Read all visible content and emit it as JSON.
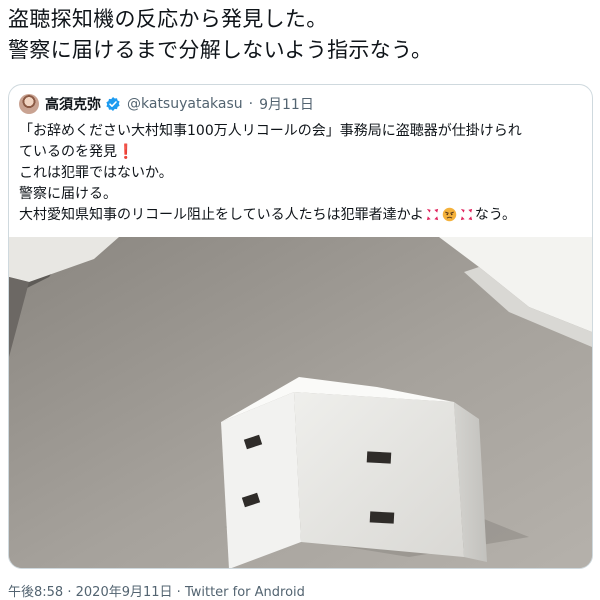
{
  "tweet": {
    "text_line1": "盗聴探知機の反応から発見した。",
    "text_line2": "警察に届けるまで分解しないよう指示なう。"
  },
  "quote": {
    "display_name": "高須克弥",
    "handle": "@katsuyatakasu",
    "separator": "·",
    "date": "9月11日",
    "line1": "「お辞めください大村知事100万人リコールの会」事務局に盗聴器が仕掛けられ",
    "line2_text": "ているのを発見",
    "line2_mark": "❗",
    "line3": "これは犯罪ではないか。",
    "line4": "警察に届ける。",
    "line5_text": "大村愛知県知事のリコール阻止をしている人たちは犯罪者達かよ",
    "line5_suffix": "なう。",
    "emoji_names": [
      "anger-symbol-icon",
      "angry-face-icon",
      "anger-symbol-icon"
    ],
    "verified_color": "#1d9bf0"
  },
  "footer": {
    "time": "午後8:58",
    "sep1": "·",
    "date": "2020年9月11日",
    "sep2": "·",
    "source": "Twitter for Android"
  }
}
